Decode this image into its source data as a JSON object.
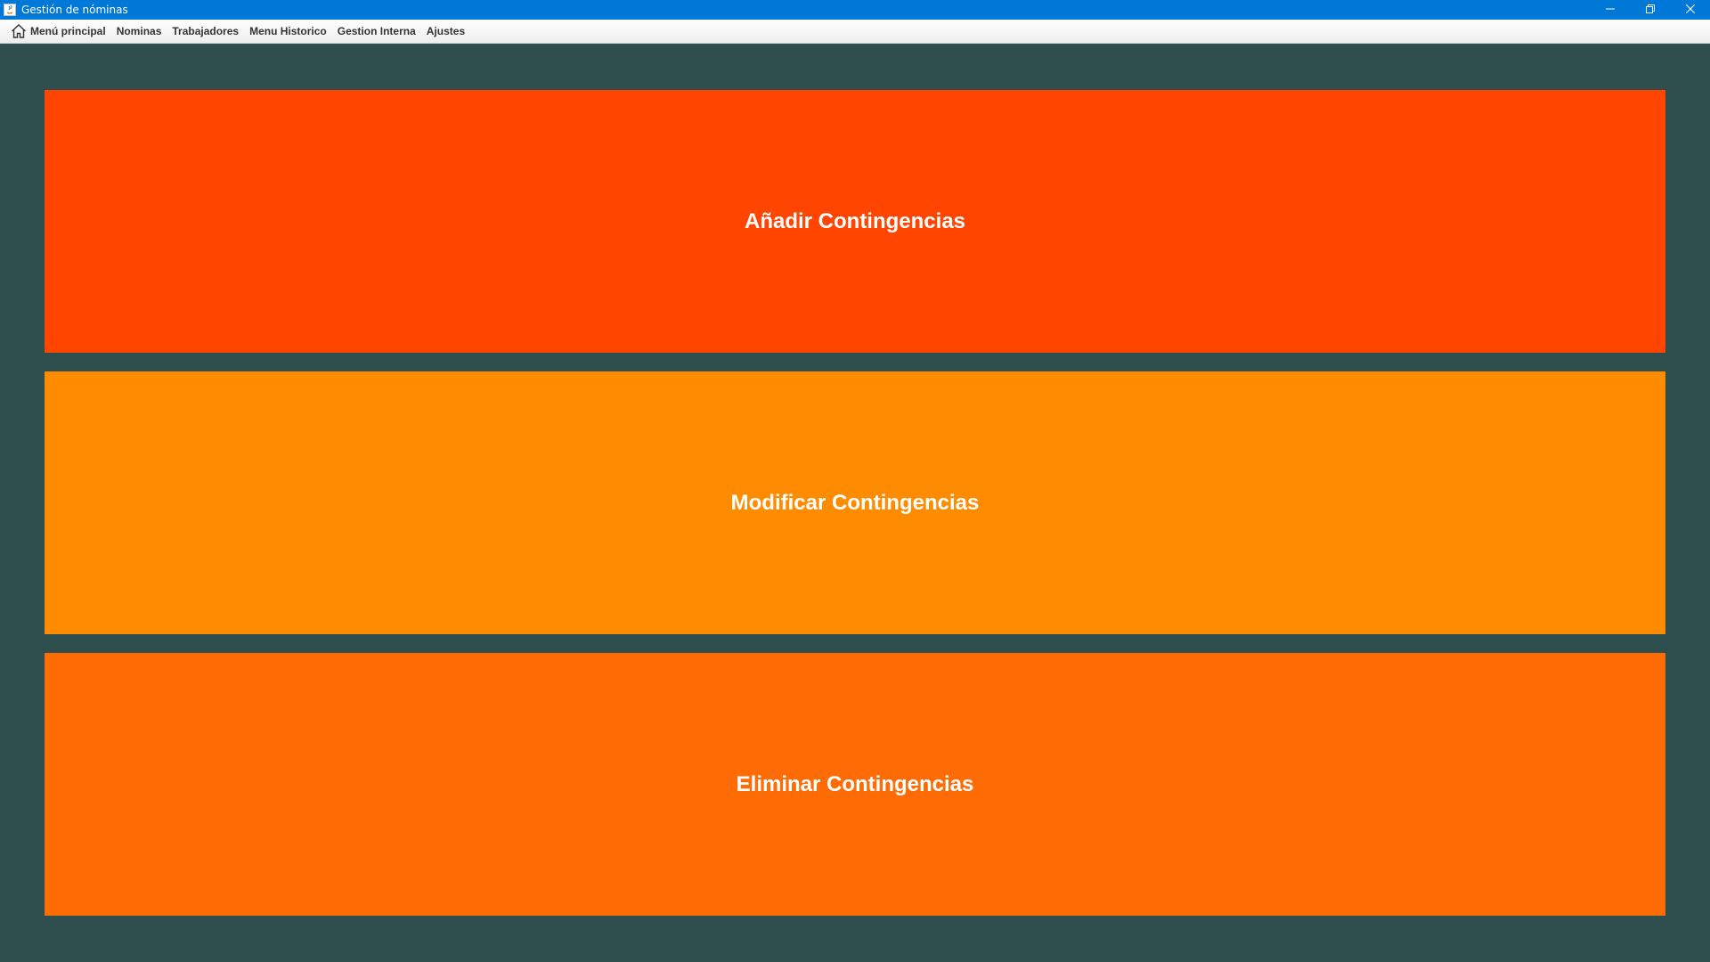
{
  "window": {
    "title": "Gestión de nóminas",
    "accent_color": "#0078d7",
    "icon": "java-app-icon",
    "controls": [
      "minimize-icon",
      "restore-icon",
      "close-icon"
    ]
  },
  "menubar": {
    "items": [
      {
        "label": "Menú principal",
        "icon": "home-icon"
      },
      {
        "label": "Nominas"
      },
      {
        "label": "Trabajadores"
      },
      {
        "label": "Menu Historico"
      },
      {
        "label": "Gestion Interna"
      },
      {
        "label": "Ajustes"
      }
    ]
  },
  "main": {
    "background_color": "#2f4f4f",
    "actions": [
      {
        "label": "Añadir Contingencias",
        "color": "#ff4500"
      },
      {
        "label": "Modificar Contingencias",
        "color": "#ff8c00"
      },
      {
        "label": "Eliminar Contingencias",
        "color": "#ff6b04"
      }
    ]
  }
}
